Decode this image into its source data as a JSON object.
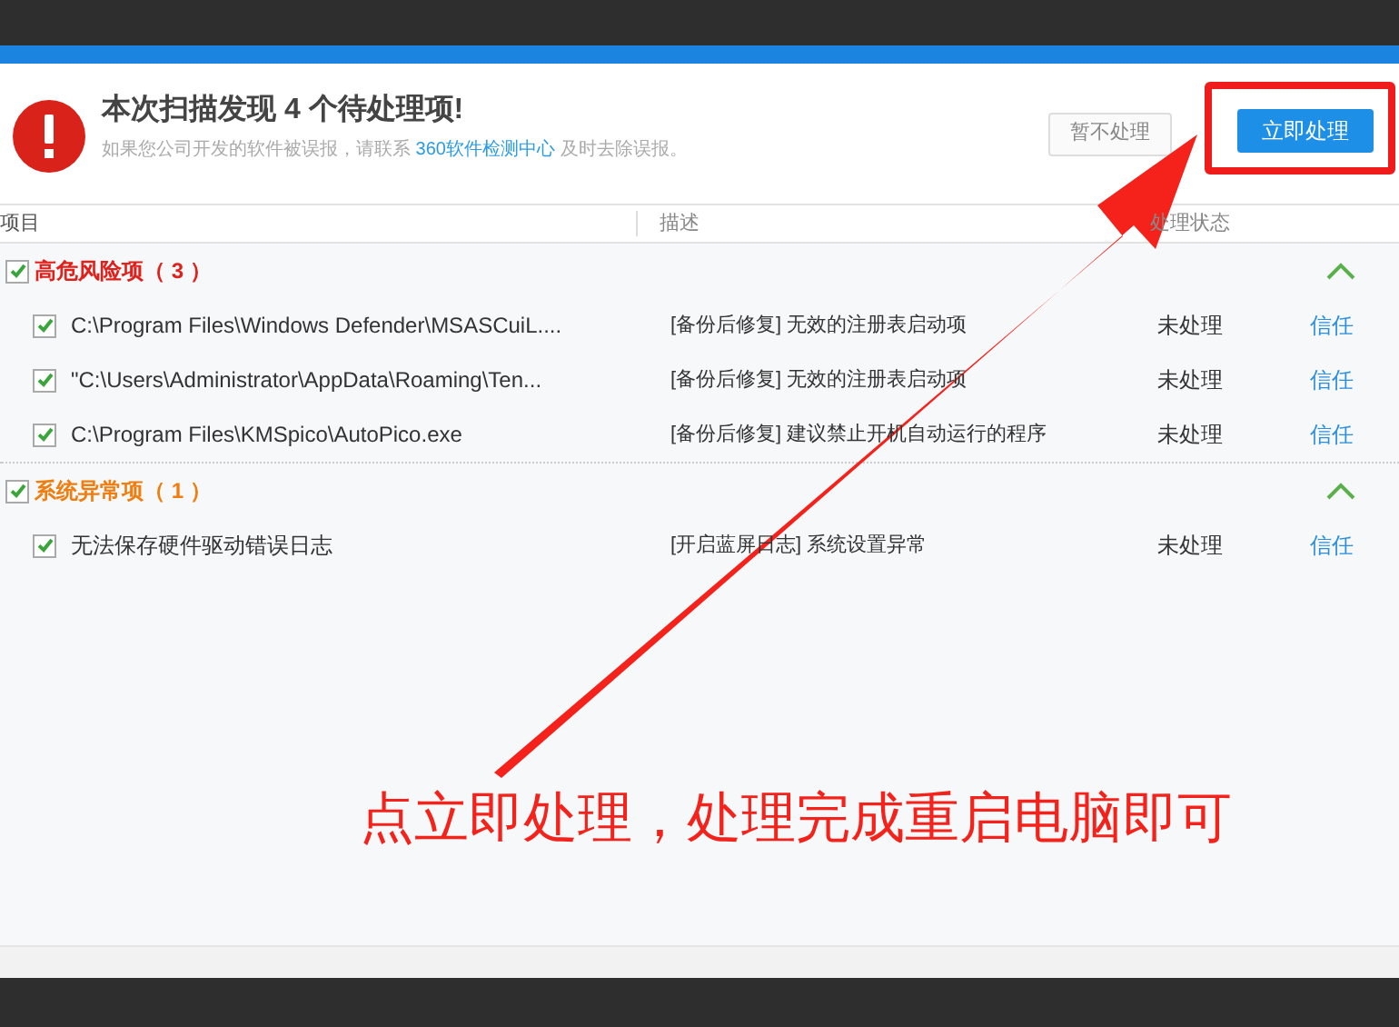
{
  "header": {
    "title": "本次扫描发现 4 个待处理项!",
    "subtitle_before": "如果您公司开发的软件被误报，请联系",
    "subtitle_link": "360软件检测中心",
    "subtitle_after": "及时去除误报。"
  },
  "buttons": [
    {
      "label": "暂不处理",
      "kind": "secondary"
    },
    {
      "label": "立即处理",
      "kind": "primary",
      "highlighted": true
    }
  ],
  "table": {
    "columns": [
      "项目",
      "描述",
      "处理状态"
    ],
    "groups": [
      {
        "label": "高危风险项",
        "count": "（ 3 ）",
        "color": "#e0201b",
        "checked": true,
        "expanded": true,
        "rows": [
          {
            "path": "C:\\Program Files\\Windows Defender\\MSASCuiL....",
            "description": "[备份后修复] 无效的注册表启动项",
            "status": "未处理",
            "action": "信任",
            "checked": true
          },
          {
            "path": "\"C:\\Users\\Administrator\\AppData\\Roaming\\Ten...",
            "description": "[备份后修复] 无效的注册表启动项",
            "status": "未处理",
            "action": "信任",
            "checked": true
          },
          {
            "path": "C:\\Program Files\\KMSpico\\AutoPico.exe",
            "description": "[备份后修复] 建议禁止开机自动运行的程序",
            "status": "未处理",
            "action": "信任",
            "checked": true
          }
        ]
      },
      {
        "label": "系统异常项",
        "count": "（ 1 ）",
        "color": "#f07d0f",
        "checked": true,
        "expanded": true,
        "rows": [
          {
            "path": "无法保存硬件驱动错误日志",
            "description": "[开启蓝屏日志] 系统设置异常",
            "status": "未处理",
            "action": "信任",
            "checked": true
          }
        ]
      }
    ]
  },
  "annotation": {
    "caption": "点立即处理，处理完成重启电脑即可"
  }
}
